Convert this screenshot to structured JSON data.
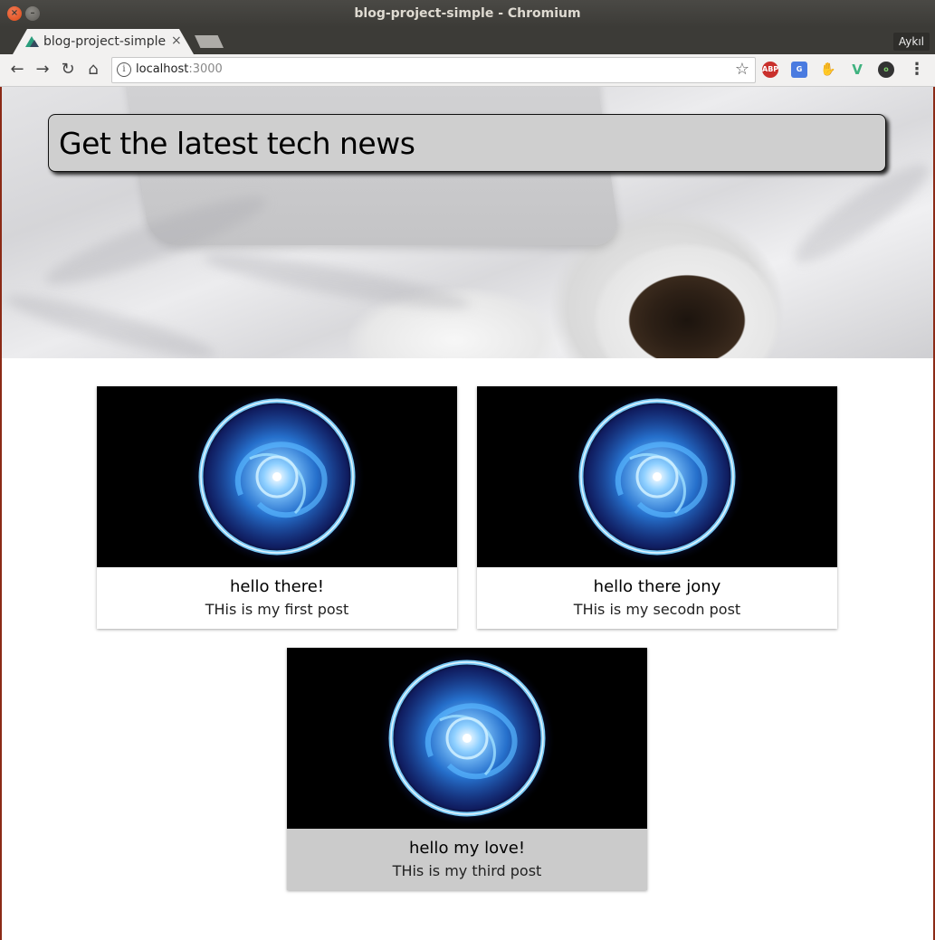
{
  "window": {
    "title": "blog-project-simple - Chromium"
  },
  "tabs": [
    {
      "label": "blog-project-simple",
      "active": true
    }
  ],
  "profile_label": "Aykıl",
  "omnibox": {
    "host": "localhost",
    "port": ":3000"
  },
  "extensions": [
    "ABP",
    "G",
    "gnome",
    "V",
    "o"
  ],
  "hero": {
    "title": "Get the latest tech news"
  },
  "posts": [
    {
      "title": "hello there!",
      "text": "THis is my first post",
      "hovered": false
    },
    {
      "title": "hello there jony",
      "text": "THis is my secodn post",
      "hovered": false
    },
    {
      "title": "hello my love!",
      "text": "THis is my third post",
      "hovered": true
    }
  ],
  "colors": {
    "title_bar": "#3c3b37",
    "close_button": "#df4a16",
    "hero_box": "#cfcfcf",
    "card_hover": "#cbcbcb",
    "orb_glow": "#2f8cff"
  }
}
